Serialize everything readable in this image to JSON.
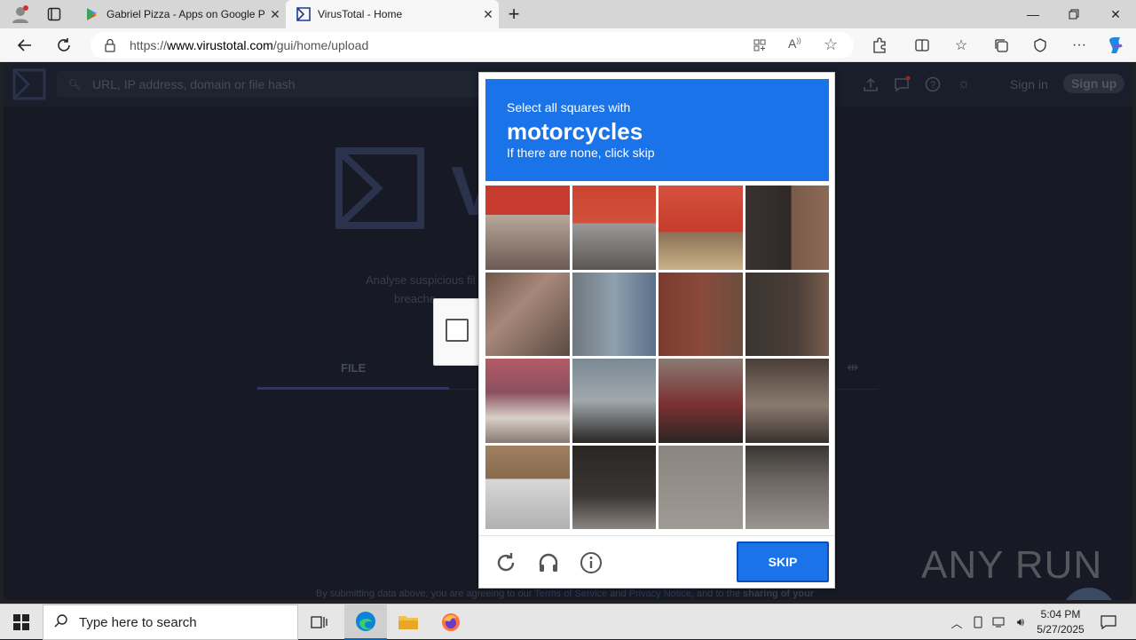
{
  "browser": {
    "tabs": [
      {
        "title": "Gabriel Pizza - Apps on Google P",
        "icon": "google-play-icon",
        "active": false
      },
      {
        "title": "VirusTotal - Home",
        "icon": "virustotal-icon",
        "active": true
      }
    ],
    "address": {
      "prefix": "https://",
      "host": "www.virustotal.com",
      "path": "/gui/home/upload"
    }
  },
  "virustotal": {
    "search_placeholder": "URL, IP address, domain or file hash",
    "sign_in": "Sign in",
    "sign_up": "Sign up",
    "logo_letter": "V",
    "tagline_line1": "Analyse suspicious fil",
    "tagline_line2": "breache",
    "file_tab": "FILE",
    "footer": {
      "prefix": "By submitting data above, you are agreeing to our ",
      "terms": "Terms of Service",
      "and": " and ",
      "privacy": "Privacy Notice",
      "suffix": ", and to the ",
      "bold": "sharing of your"
    }
  },
  "captcha": {
    "prompt": "Select all squares with",
    "target": "motorcycles",
    "hint": "If there are none, click skip",
    "skip_label": "SKIP",
    "accent_color": "#1a73e8"
  },
  "watermark": "ANY RUN",
  "taskbar": {
    "search_placeholder": "Type here to search",
    "time": "5:04 PM",
    "date": "5/27/2025"
  }
}
